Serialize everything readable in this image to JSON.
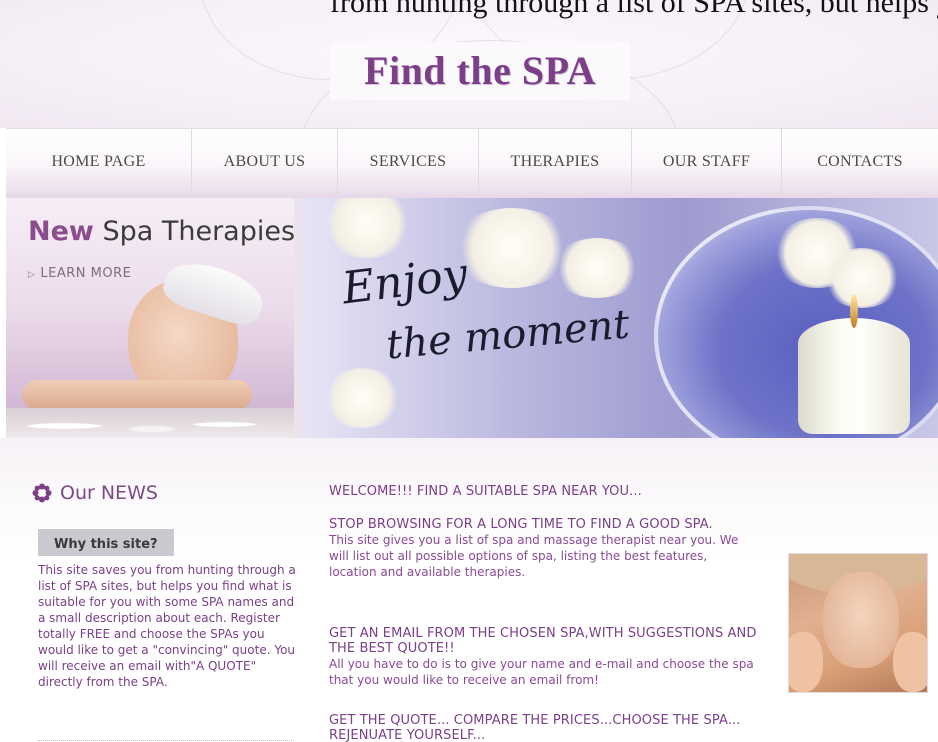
{
  "top_fragment": "from hunting through a list of SPA sites, but helps you find what is suitable for you with some SPA names and a small description about each.",
  "logo": "Find the SPA",
  "nav": [
    "HOME PAGE",
    "ABOUT US",
    "SERVICES",
    "THERAPIES",
    "OUR STAFF",
    "CONTACTS"
  ],
  "banner": {
    "promo_new": "New",
    "promo_rest": " Spa Therapies",
    "learn_more": "LEARN MORE",
    "script_line1": "Enjoy",
    "script_line2": "the moment"
  },
  "sidebar": {
    "title": "Our NEWS",
    "button": "Why this site?",
    "text": "This site saves you from hunting through a list of SPA sites, but helps you find what is suitable for you with some SPA names and a small description about each. Register totally FREE and choose the SPAs you would like to get a \"convincing\" quote. You will receive an email with\"A QUOTE\" directly from the SPA."
  },
  "main": {
    "h_welcome": "WELCOME!!! FIND A SUITABLE SPA NEAR YOU...",
    "h_stop": "STOP BROWSING FOR A LONG TIME TO FIND A GOOD SPA.",
    "p_stop": "This site gives you a list of spa and massage therapist near you. We will list out all possible options of spa, listing the best features, location and available therapies.",
    "h_email": "GET AN EMAIL FROM THE CHOSEN SPA,WITH SUGGESTIONS AND THE BEST QUOTE!!",
    "p_email": "All you have to do is to give your name and e-mail and choose the spa that you would like to receive an email from!",
    "h_quote": "GET THE QUOTE... COMPARE THE PRICES...CHOOSE THE SPA... REJENUATE YOURSELF..."
  }
}
